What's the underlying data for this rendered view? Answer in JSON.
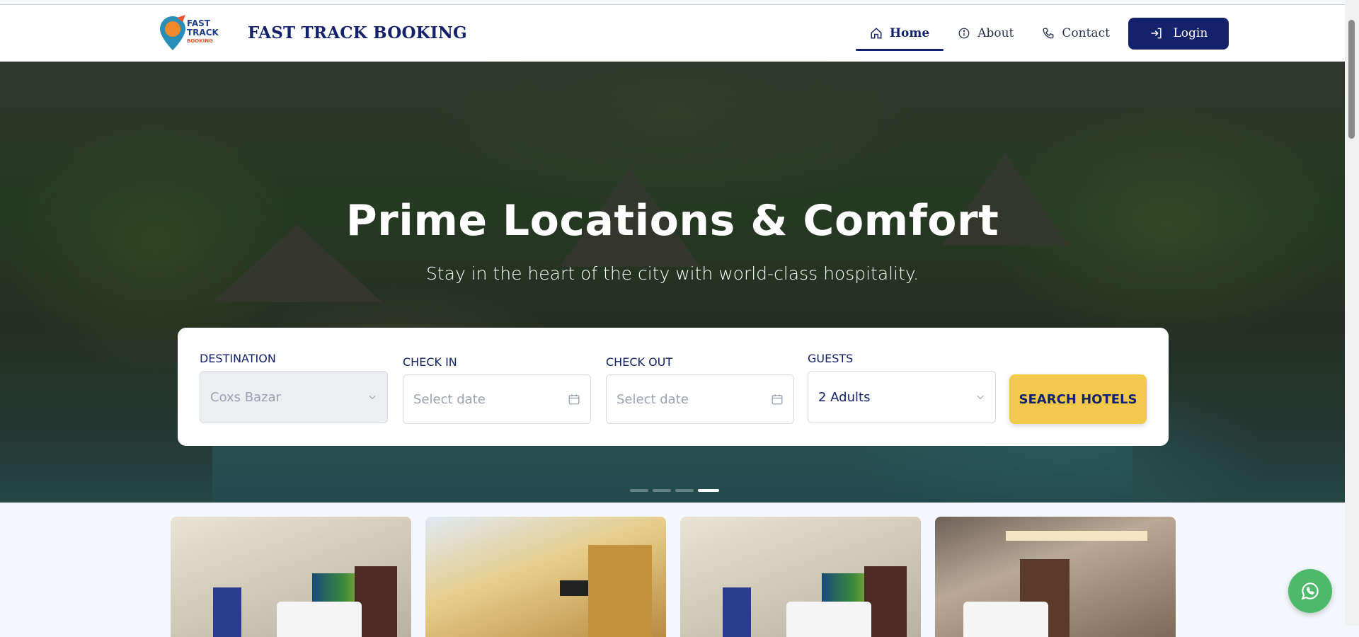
{
  "header": {
    "brand": "FAST TRACK BOOKING",
    "logo_text": [
      "FAST",
      "TRACK",
      "BOOKING"
    ],
    "nav": [
      {
        "label": "Home",
        "icon": "home-icon",
        "active": true
      },
      {
        "label": "About",
        "icon": "info-icon",
        "active": false
      },
      {
        "label": "Contact",
        "icon": "phone-icon",
        "active": false
      }
    ],
    "login_label": "Login"
  },
  "hero": {
    "title": "Prime Locations & Comfort",
    "subtitle": "Stay in the heart of the city with world-class hospitality.",
    "slides_total": 4,
    "active_slide": 4
  },
  "search": {
    "destination_label": "DESTINATION",
    "destination_value": "Coxs Bazar",
    "checkin_label": "CHECK IN",
    "checkin_placeholder": "Select date",
    "checkout_label": "CHECK OUT",
    "checkout_placeholder": "Select date",
    "guests_label": "GUESTS",
    "guests_value": "2 Adults",
    "button_label": "SEARCH HOTELS"
  },
  "colors": {
    "primary": "#13226b",
    "accent": "#f2c94c",
    "whatsapp": "#4cba6a"
  }
}
